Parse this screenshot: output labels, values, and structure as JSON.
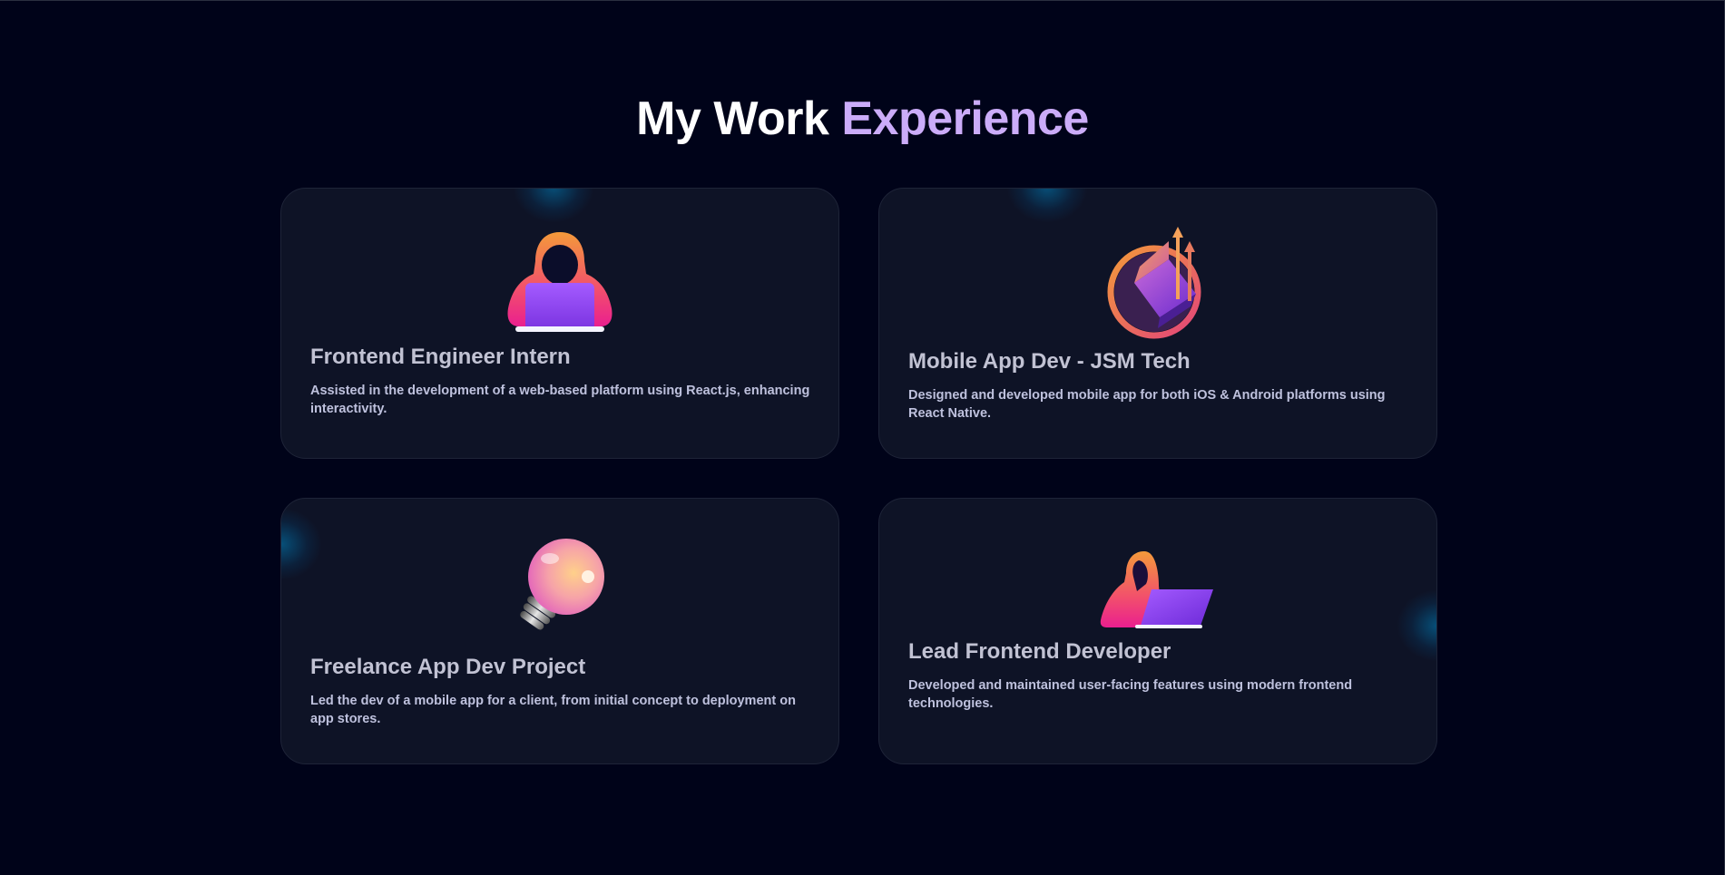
{
  "heading": {
    "prefix": "My Work ",
    "accent": "Experience"
  },
  "colors": {
    "background": "#000319",
    "card": "#0e1326",
    "accent": "#cbacf9",
    "title": "#c1c2d3",
    "description": "#bec1dd"
  },
  "experiences": [
    {
      "title": "Frontend Engineer Intern",
      "description": "Assisted in the development of a web-based platform using React.js, enhancing interactivity.",
      "icon": "hooded-coder-laptop-icon"
    },
    {
      "title": "Mobile App Dev - JSM Tech",
      "description": "Designed and developed mobile app for both iOS & Android platforms using React Native.",
      "icon": "growth-chart-icon"
    },
    {
      "title": "Freelance App Dev Project",
      "description": "Led the dev of a mobile app for a client, from initial concept to deployment on app stores.",
      "icon": "lightbulb-icon"
    },
    {
      "title": "Lead Frontend Developer",
      "description": "Developed and maintained user-facing features using modern frontend technologies.",
      "icon": "hooded-developer-laptop-icon"
    }
  ]
}
